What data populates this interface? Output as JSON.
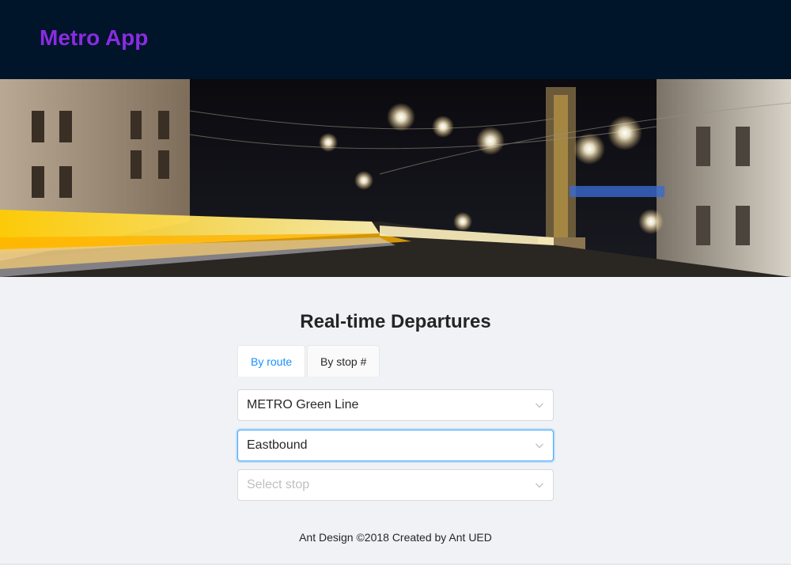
{
  "header": {
    "app_title": "Metro App"
  },
  "hero": {
    "image": "city-street-night-photo"
  },
  "main": {
    "title": "Real-time Departures",
    "tabs": [
      {
        "label": "By route",
        "active": true
      },
      {
        "label": "By stop #",
        "active": false
      }
    ],
    "route_select": {
      "value": "METRO Green Line",
      "icon": "chevron-down-icon"
    },
    "direction_select": {
      "value": "Eastbound",
      "icon": "chevron-down-icon",
      "focused": true
    },
    "stop_select": {
      "placeholder": "Select stop",
      "icon": "chevron-down-icon"
    }
  },
  "footer": {
    "text": "Ant Design ©2018 Created by Ant UED"
  },
  "colors": {
    "header_bg": "#001529",
    "logo": "#8a2be2",
    "accent": "#1890ff",
    "page_bg": "#f0f2f5"
  }
}
